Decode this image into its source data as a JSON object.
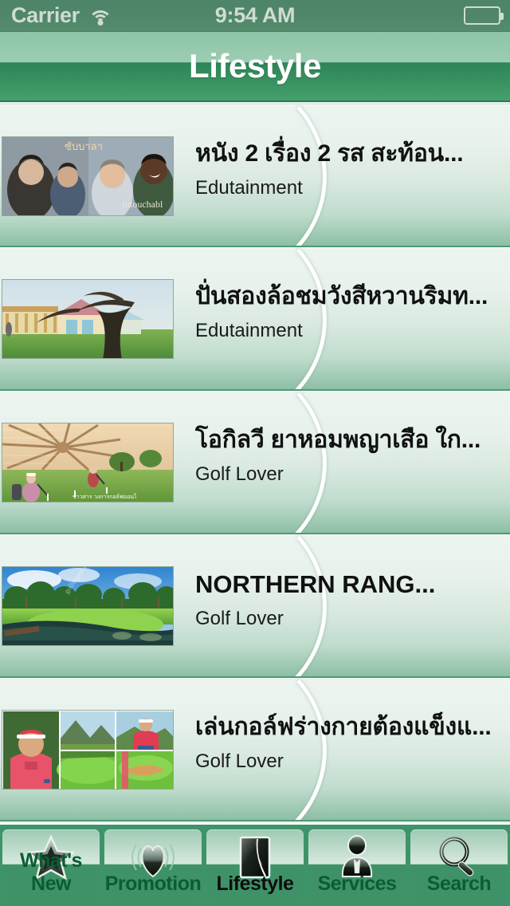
{
  "status_bar": {
    "carrier": "Carrier",
    "wifi_icon": "wifi-icon",
    "time": "9:54 AM",
    "battery_icon": "battery-icon"
  },
  "nav_bar": {
    "title": "Lifestyle"
  },
  "list": {
    "items": [
      {
        "title": "หนัง 2 เรื่อง 2 รส สะท้อน...",
        "subtitle": "Edutainment",
        "thumbnail": "movie-poster-collage-thumbnail",
        "script": "thai"
      },
      {
        "title": "ปั่นสองล้อชมวังสีหวานริมท...",
        "subtitle": "Edutainment",
        "thumbnail": "palace-with-tree-thumbnail",
        "script": "thai"
      },
      {
        "title": "โอกิลวี ยาหอมพญาเสือ ใก...",
        "subtitle": "Golf Lover",
        "thumbnail": "indoor-driving-range-thumbnail",
        "script": "thai"
      },
      {
        "title": "NORTHERN RANG...",
        "subtitle": "Golf Lover",
        "thumbnail": "golf-course-water-thumbnail",
        "script": "latin"
      },
      {
        "title": "เล่นกอล์ฟร่างกายต้องแข็งแ...",
        "subtitle": "Golf Lover",
        "thumbnail": "golfer-photo-grid-thumbnail",
        "script": "thai"
      }
    ]
  },
  "tab_bar": {
    "selected": "Lifestyle",
    "tabs": [
      {
        "label": "What's New",
        "icon": "star-icon"
      },
      {
        "label": "Promotion",
        "icon": "heart-icon"
      },
      {
        "label": "Lifestyle",
        "icon": "book-page-icon"
      },
      {
        "label": "Services",
        "icon": "person-icon"
      },
      {
        "label": "Search",
        "icon": "magnifier-icon"
      }
    ]
  },
  "colors": {
    "brand_green": "#3d9468",
    "nav_dark_green": "#2e8558",
    "nav_light_green": "#9ccdb2",
    "row_background_top": "#ecf4f0",
    "row_background_bottom": "#8dbfa5",
    "tab_label": "#0a5c33",
    "tab_label_selected": "#0d0d0d",
    "status_text": "#cfdcd4"
  }
}
